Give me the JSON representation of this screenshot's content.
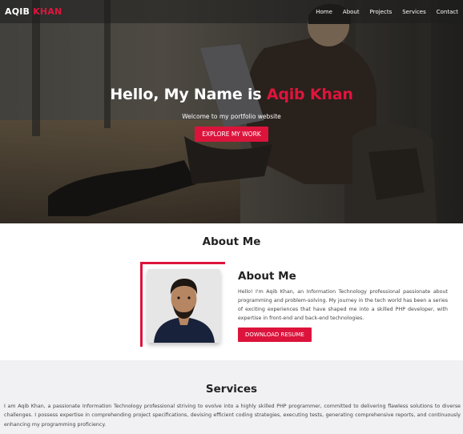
{
  "nav": {
    "brand_first": "AQIB",
    "brand_last": "KHAN",
    "links": [
      "Home",
      "About",
      "Projects",
      "Services",
      "Contact"
    ]
  },
  "hero": {
    "title_prefix": "Hello, My Name is",
    "title_name": "Aqib Khan",
    "subtitle": "Welcome to my portfolio website",
    "button_label": "EXPLORE MY WORK"
  },
  "about": {
    "section_title": "About Me",
    "heading": "About Me",
    "paragraph": "Hello! I'm Aqib Khan, an Information Technology professional passionate about programming and problem-solving. My journey in the tech world has been a series of exciting experiences that have shaped me into a skilled PHP developer, with expertise in front-end and back-end technologies.",
    "button_label": "DOWNLOAD RESUME"
  },
  "services": {
    "section_title": "Services",
    "paragraph": "I am Aqib Khan, a passionate Information Technology professional striving to evolve into a highly skilled PHP programmer, committed to delivering flawless solutions to diverse challenges. I possess expertise in comprehending project specifications, devising efficient coding strategies, executing tests, generating comprehensive reports, and continuously enhancing my programming proficiency."
  },
  "colors": {
    "accent": "#dc143c",
    "nav_bg": "#1e1e1e",
    "services_bg": "#f1f1f3"
  }
}
